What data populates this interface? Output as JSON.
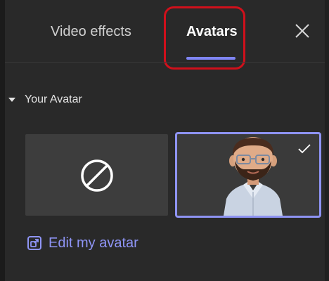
{
  "tabs": [
    {
      "label": "Video effects",
      "active": false
    },
    {
      "label": "Avatars",
      "active": true
    }
  ],
  "section": {
    "title": "Your Avatar",
    "expanded": true
  },
  "avatar_options": [
    {
      "type": "none",
      "selected": false
    },
    {
      "type": "avatar",
      "selected": true
    }
  ],
  "edit_link": {
    "label": "Edit my avatar"
  },
  "colors": {
    "accent": "#7f85f5",
    "highlight_annotation": "#d0101b",
    "background": "#292929"
  }
}
